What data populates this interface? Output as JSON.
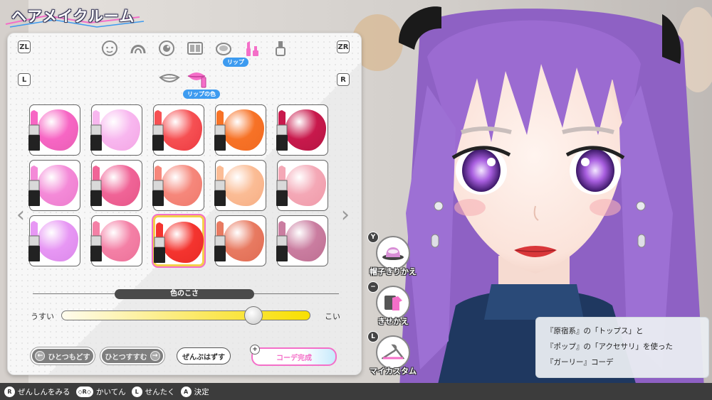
{
  "screen": {
    "title": "ヘアメイクルーム",
    "accent_pink": "#f46fc8",
    "accent_blue": "#3d9bf0"
  },
  "panel": {
    "key_zl": "ZL",
    "key_zr": "ZR",
    "key_l": "L",
    "key_r": "R",
    "categories": [
      {
        "icon": "face-base-icon",
        "selected": false
      },
      {
        "icon": "eyebrow-icon",
        "selected": false
      },
      {
        "icon": "eye-icon",
        "selected": false
      },
      {
        "icon": "eyeshadow-palette-icon",
        "selected": false
      },
      {
        "icon": "compact-blush-icon",
        "selected": false
      },
      {
        "icon": "lipstick-icon",
        "selected": true
      },
      {
        "icon": "nail-polish-icon",
        "selected": false
      }
    ],
    "category_selected_label": "リップ",
    "subcategories": [
      {
        "icon": "lip-shape-icon",
        "selected": false
      },
      {
        "icon": "lip-color-icon",
        "selected": true
      }
    ],
    "subcategory_selected_label": "リップの色",
    "swatches": [
      {
        "color": "#f766c4",
        "body": "#e85eb4",
        "selected": false
      },
      {
        "color": "#f8b7ef",
        "body": "#f3a5e4",
        "selected": false
      },
      {
        "color": "#f65053",
        "body": "#ec3a41",
        "selected": false
      },
      {
        "color": "#f77226",
        "body": "#f06a22",
        "selected": false
      },
      {
        "color": "#c8194c",
        "body": "#b51543",
        "selected": false
      },
      {
        "color": "#f48ad8",
        "body": "#ec7ccd",
        "selected": false
      },
      {
        "color": "#f06497",
        "body": "#e65688",
        "selected": false
      },
      {
        "color": "#f6877b",
        "body": "#ef7a6c",
        "selected": false
      },
      {
        "color": "#fbbc95",
        "body": "#f6ae84",
        "selected": false
      },
      {
        "color": "#f4a8b6",
        "body": "#ef9aa9",
        "selected": false
      },
      {
        "color": "#e797f4",
        "body": "#db88ea",
        "selected": false
      },
      {
        "color": "#f480a6",
        "body": "#ec7199",
        "selected": false
      },
      {
        "color": "#f4342f",
        "body": "#e92b26",
        "selected": true
      },
      {
        "color": "#e87a61",
        "body": "#e06c53",
        "selected": false
      },
      {
        "color": "#ca7da0",
        "body": "#bd6f92",
        "selected": false
      }
    ],
    "slider": {
      "label": "色のこさ",
      "min_label": "うすい",
      "max_label": "こい",
      "value": 0.77
    },
    "buttons": {
      "undo": "ひとつもどす",
      "redo": "ひとつすすむ",
      "remove_all": "ぜんぶはずす",
      "finish": "コーデ完成",
      "finish_key": "+"
    }
  },
  "actions": [
    {
      "key": "Y",
      "label": "帽子きりかえ",
      "icon": "hat-icon"
    },
    {
      "key": "−",
      "label": "きせかえ",
      "icon": "outfit-icon"
    },
    {
      "key": "L",
      "label": "マイカスタム",
      "icon": "hanger-icon"
    }
  ],
  "info": {
    "lines": [
      "『原宿系』の「トップス」と",
      "『ポップ』の「アクセサリ」を使った",
      "『ガーリー』コーデ"
    ]
  },
  "bottom_bar": {
    "hints": [
      {
        "key": "R",
        "label": "ぜんしんをみる"
      },
      {
        "key": "◇R◇",
        "label": "かいてん"
      },
      {
        "key": "L",
        "label": "せんたく"
      },
      {
        "key": "A",
        "label": "決定"
      }
    ]
  }
}
